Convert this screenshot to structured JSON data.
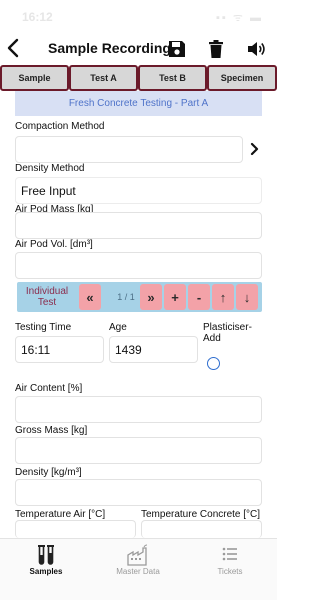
{
  "status_bar": {
    "time": "16:12",
    "indicators": "▪▪ ᯤ ▬"
  },
  "header": {
    "title": "Sample Recording",
    "back_icon": "chevron-left-icon",
    "actions": [
      "save-icon",
      "trash-icon",
      "speaker-icon"
    ]
  },
  "tabs": [
    {
      "label": "Sample"
    },
    {
      "label": "Test A"
    },
    {
      "label": "Test B"
    },
    {
      "label": "Specimen"
    }
  ],
  "section": {
    "title": "Fresh Concrete Testing - Part A"
  },
  "form": {
    "compaction_method": {
      "label": "Compaction Method",
      "value": ""
    },
    "density_method": {
      "label": "Density Method",
      "value": "Free Input"
    },
    "air_pod_mass": {
      "label": "Air Pod Mass [kg]",
      "value": ""
    },
    "air_pod_vol": {
      "label": "Air Pod Vol. [dm³]",
      "value": ""
    },
    "testing_time": {
      "label": "Testing Time",
      "value": "16:11"
    },
    "age": {
      "label": "Age",
      "value": "1439"
    },
    "plasticiser": {
      "label_line1": "Plasticiser-",
      "label_line2": "Add"
    },
    "air_content": {
      "label": "Air Content [%]",
      "value": ""
    },
    "gross_mass": {
      "label": "Gross Mass [kg]",
      "value": ""
    },
    "density": {
      "label": "Density [kg/m³]",
      "value": ""
    },
    "temperature_air": {
      "label": "Temperature Air [°C]",
      "value": ""
    },
    "temperature_concrete": {
      "label": "Temperature Concrete [°C]",
      "value": ""
    }
  },
  "individual_test": {
    "label_line1": "Individual",
    "label_line2": "Test",
    "first": "«",
    "counter": "1 / 1",
    "last": "»",
    "add": "+",
    "remove": "-",
    "up": "↑",
    "down": "↓"
  },
  "bottom_nav": [
    {
      "label": "Samples",
      "icon": "test-tubes-icon"
    },
    {
      "label": "Master Data",
      "icon": "factory-icon"
    },
    {
      "label": "Tickets",
      "icon": "list-icon"
    }
  ],
  "colors": {
    "tab_border": "#6b1a2a",
    "section_bg": "#d8e0f4",
    "section_text": "#4f73c9",
    "strip_bg": "#a6d2e7",
    "button_pink": "#f3a2a8",
    "radio": "#2f6ecf"
  }
}
